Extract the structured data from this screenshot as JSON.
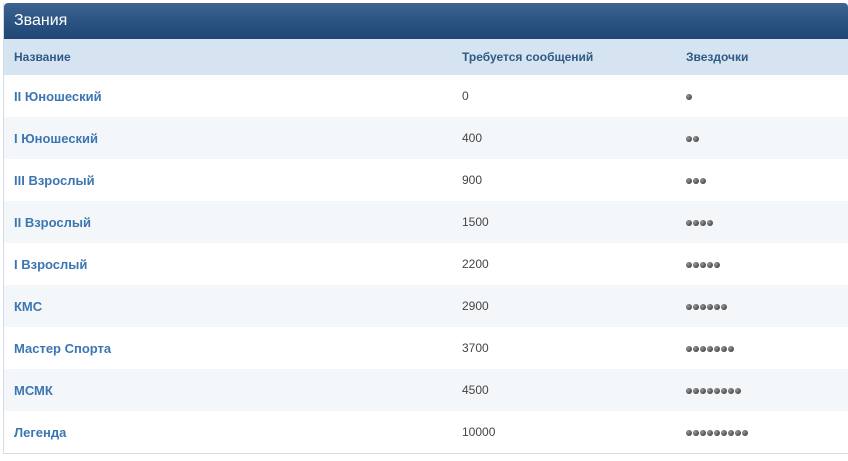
{
  "panel": {
    "title": "Звания"
  },
  "columns": {
    "name": "Название",
    "messages": "Требуется сообщений",
    "stars": "Звездочки"
  },
  "ranks": [
    {
      "name": "II Юношеский",
      "messages": "0",
      "stars": 1
    },
    {
      "name": "I Юношеский",
      "messages": "400",
      "stars": 2
    },
    {
      "name": "III Взрослый",
      "messages": "900",
      "stars": 3
    },
    {
      "name": "II Взрослый",
      "messages": "1500",
      "stars": 4
    },
    {
      "name": "I Взрослый",
      "messages": "2200",
      "stars": 5
    },
    {
      "name": "КМС",
      "messages": "2900",
      "stars": 6
    },
    {
      "name": "Мастер Спорта",
      "messages": "3700",
      "stars": 7
    },
    {
      "name": "МСМК",
      "messages": "4500",
      "stars": 8
    },
    {
      "name": "Легенда",
      "messages": "10000",
      "stars": 9
    }
  ],
  "icons": {
    "star": "star-dot-icon"
  }
}
